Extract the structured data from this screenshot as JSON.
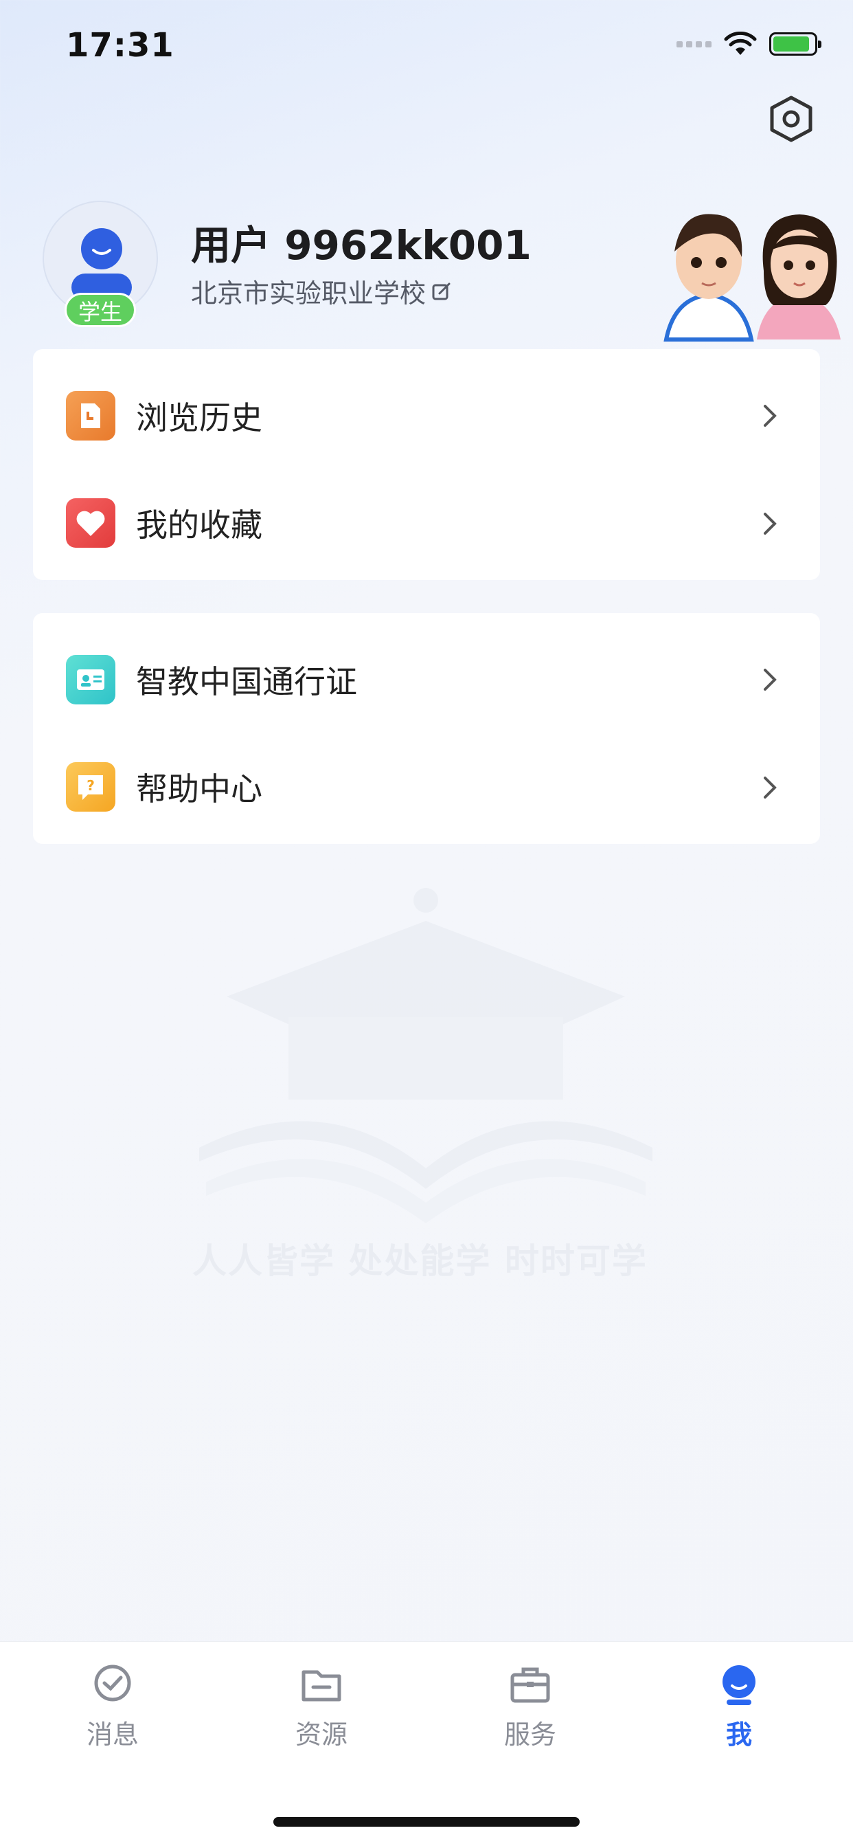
{
  "status_bar": {
    "time": "17:31",
    "battery_level": 0.9
  },
  "header": {
    "settings_icon": "settings-icon"
  },
  "profile": {
    "name": "用户 9962kk001",
    "school": "北京市实验职业学校",
    "role_badge": "学生"
  },
  "menu_group_1": [
    {
      "label": "浏览历史",
      "icon": "history-icon",
      "color": "#f08a3c"
    },
    {
      "label": "我的收藏",
      "icon": "heart-icon",
      "color": "#ef4a4a"
    }
  ],
  "menu_group_2": [
    {
      "label": "智教中国通行证",
      "icon": "id-card-icon",
      "color": "#3dcfc3"
    },
    {
      "label": "帮助中心",
      "icon": "help-icon",
      "color": "#f7b733"
    }
  ],
  "watermark": {
    "slogan": "人人皆学 处处能学  时时可学"
  },
  "tabbar": {
    "tabs": [
      {
        "label": "消息",
        "icon": "message-icon"
      },
      {
        "label": "资源",
        "icon": "folder-icon"
      },
      {
        "label": "服务",
        "icon": "briefcase-icon"
      },
      {
        "label": "我",
        "icon": "profile-icon",
        "active": true
      }
    ],
    "active_color": "#2a67f0"
  }
}
